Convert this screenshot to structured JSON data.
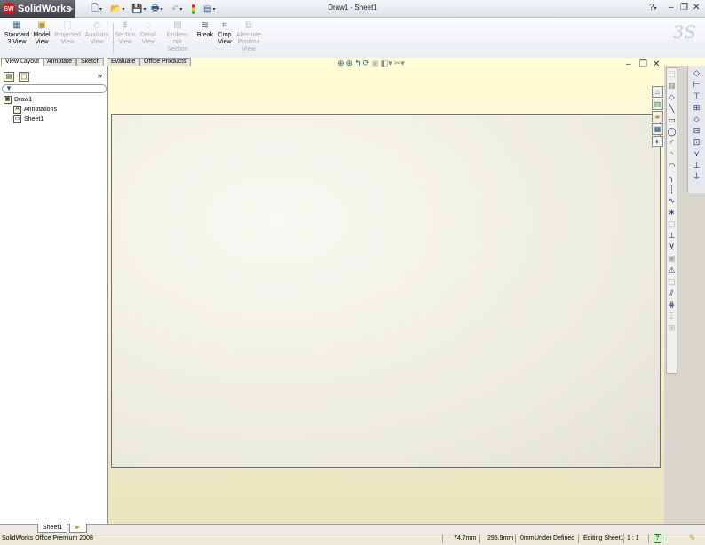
{
  "app": {
    "logo_text": "SolidWorks",
    "window_title": "Draw1 - Sheet1"
  },
  "quick_access": [
    {
      "name": "new-document-icon",
      "glyph": "🗋"
    },
    {
      "name": "open-document-icon",
      "glyph": "📂"
    },
    {
      "name": "save-icon",
      "glyph": "💾"
    },
    {
      "name": "print-icon",
      "glyph": "🖶"
    },
    {
      "name": "undo-icon",
      "glyph": "↶"
    },
    {
      "name": "rebuild-icon",
      "glyph": "🚦"
    },
    {
      "name": "options-icon",
      "glyph": "▤"
    }
  ],
  "window_controls": {
    "help": "?",
    "minimize": "–",
    "restore": "❐",
    "close": "✕"
  },
  "command_manager": [
    {
      "label_line1": "Standard",
      "label_line2": "3 View",
      "icon": "standard-3-view-icon",
      "enabled": true
    },
    {
      "label_line1": "Model",
      "label_line2": "View",
      "icon": "model-view-icon",
      "enabled": true
    },
    {
      "label_line1": "Projected",
      "label_line2": "View",
      "icon": "projected-view-icon",
      "enabled": false
    },
    {
      "label_line1": "Auxiliary",
      "label_line2": "View",
      "icon": "auxiliary-view-icon",
      "enabled": false
    },
    {
      "label_line1": "Section",
      "label_line2": "View",
      "icon": "section-view-icon",
      "enabled": false
    },
    {
      "label_line1": "Detail",
      "label_line2": "View",
      "icon": "detail-view-icon",
      "enabled": false
    },
    {
      "label_line1": "Broken-out",
      "label_line2": "Section",
      "icon": "broken-out-section-icon",
      "enabled": false
    },
    {
      "label_line1": "Break",
      "label_line2": "",
      "icon": "break-icon",
      "enabled": true
    },
    {
      "label_line1": "Crop",
      "label_line2": "View",
      "icon": "crop-view-icon",
      "enabled": true
    },
    {
      "label_line1": "Alternate",
      "label_line2": "Position View",
      "icon": "alternate-position-view-icon",
      "enabled": false
    }
  ],
  "tabs": [
    "View Layout",
    "Annotate",
    "Sketch",
    "Evaluate",
    "Office Products"
  ],
  "active_tab": "View Layout",
  "feature_tree": {
    "expand_glyph": "»",
    "root": "Draw1",
    "items": [
      "Annotations",
      "Sheet1"
    ]
  },
  "sheet_tabs": [
    "Sheet1"
  ],
  "status": {
    "product": "SolidWorks Office Premium 2008",
    "x": "74.7mm",
    "y": "295.9mm",
    "z": "0mm",
    "definition": "Under Defined",
    "mode": "Editing Sheet1",
    "scale": "1 : 1",
    "help": "?"
  },
  "colors": {
    "graphics_bg": "#fdfcd7",
    "sheet_bg": "#f2f1ea",
    "logo_red": "#c8161d"
  }
}
